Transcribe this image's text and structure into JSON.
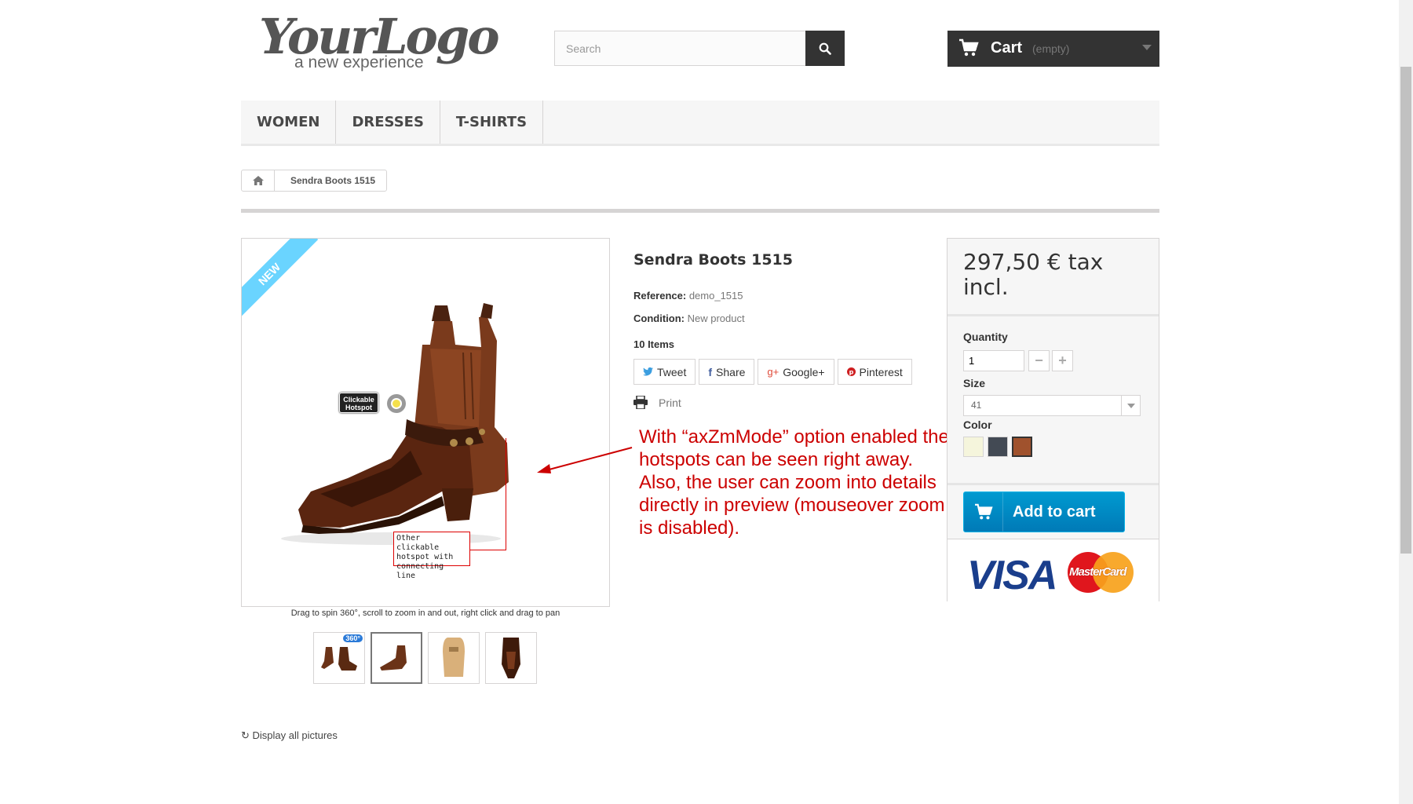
{
  "header": {
    "logo_main": "YourLogo",
    "logo_sub": "a new experience",
    "search_placeholder": "Search",
    "cart_label": "Cart",
    "cart_status": "(empty)"
  },
  "menu": [
    {
      "label": "WOMEN"
    },
    {
      "label": "DRESSES"
    },
    {
      "label": "T-SHIRTS"
    }
  ],
  "breadcrumb": {
    "current": "Sendra Boots 1515"
  },
  "viewer": {
    "ribbon": "NEW",
    "hotspot1_label": "Clickable Hotspot",
    "hotspot2_label": "Other clickable\nhotspot with\nconnecting line",
    "hint": "Drag to spin 360°, scroll to zoom in and out, right click and drag to pan",
    "thumb_badge": "360°",
    "display_all": "Display all pictures"
  },
  "product": {
    "title": "Sendra Boots 1515",
    "reference_label": "Reference:",
    "reference_value": "demo_1515",
    "condition_label": "Condition:",
    "condition_value": "New product",
    "items": "10 Items",
    "social": [
      {
        "label": "Tweet",
        "icon": "twitter-icon",
        "color": "#3b9ee0"
      },
      {
        "label": "Share",
        "icon": "facebook-icon",
        "color": "#435f9f"
      },
      {
        "label": "Google+",
        "icon": "google-plus-icon",
        "color": "#e04a39"
      },
      {
        "label": "Pinterest",
        "icon": "pinterest-icon",
        "color": "#ce1f21"
      }
    ],
    "print": "Print"
  },
  "annotation": "With “axZmMode” option enabled the hotspots can be seen right away. Also, the user can zoom into details directly in preview (mouseover zoom is disabled).",
  "buybox": {
    "price": "297,50 € tax incl.",
    "quantity_label": "Quantity",
    "quantity_value": "1",
    "size_label": "Size",
    "size_value": "41",
    "color_label": "Color",
    "colors": [
      "#f5f5dc",
      "#434a54",
      "#a0522d"
    ],
    "add_to_cart": "Add to cart",
    "visa": "VISA",
    "mastercard": "MasterCard"
  },
  "colors": {
    "accent_blue": "#009ad0",
    "annotation_red": "#c00000",
    "ribbon": "#6ad4ff"
  }
}
